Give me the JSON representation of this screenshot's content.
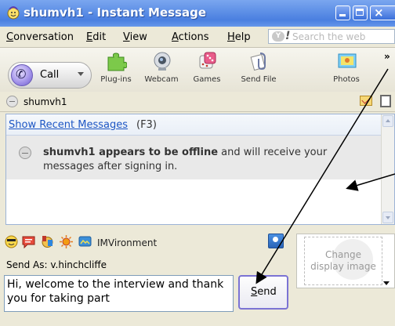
{
  "window": {
    "title": "shumvh1 - Instant Message",
    "buttons": {
      "minimize": "minimize",
      "maximize": "maximize",
      "close": "×"
    }
  },
  "menu": {
    "items": [
      {
        "label": "Conversation",
        "accel": "C"
      },
      {
        "label": "Edit",
        "accel": "E"
      },
      {
        "label": "View",
        "accel": "V"
      },
      {
        "label": "Actions",
        "accel": "A"
      },
      {
        "label": "Help",
        "accel": "H"
      }
    ],
    "search_placeholder": "Search the web",
    "search_logo": "Y!"
  },
  "toolbar": {
    "call_label": "Call",
    "tools": [
      {
        "label": "Plug-ins",
        "icon": "plugin-puzzle-icon"
      },
      {
        "label": "Webcam",
        "icon": "webcam-icon"
      },
      {
        "label": "Games",
        "icon": "dice-icon"
      },
      {
        "label": "Send File",
        "icon": "paperclip-icon"
      },
      {
        "label": "Photos",
        "icon": "photos-icon"
      }
    ],
    "more": "»"
  },
  "contact": {
    "name": "shumvh1"
  },
  "messages": {
    "recent_link": "Show Recent Messages",
    "recent_shortcut": "(F3)",
    "notice_bold": "shumvh1 appears to be offline",
    "notice_rest": " and will receive your messages after signing in."
  },
  "composer": {
    "imvironment_label": "IMVironment",
    "send_as": "Send As: v.hinchcliffe",
    "input_value": "Hi, welcome to the interview and thank you for taking part",
    "send_label": "Send",
    "send_accel": "S"
  },
  "display_image": {
    "line1": "Change",
    "line2": "display image"
  },
  "colors": {
    "title_bar": "#5d8fe6",
    "link": "#1d56c4",
    "send_border": "#7b73d4"
  }
}
